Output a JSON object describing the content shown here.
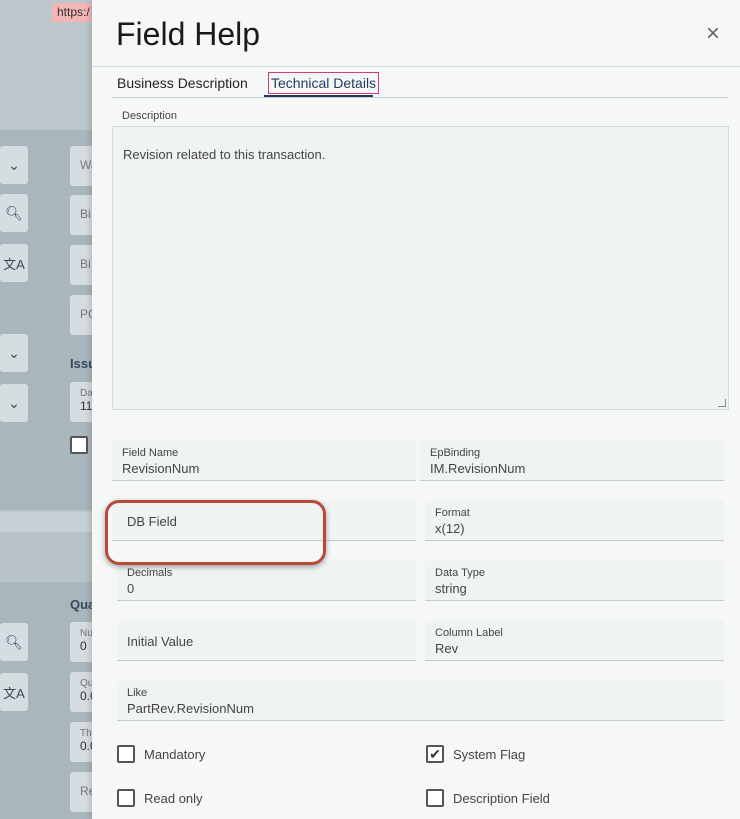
{
  "browser": {
    "url_fragment": "https:/"
  },
  "background": {
    "fields": [
      "Wa",
      "Bi",
      "Bi",
      "PC"
    ],
    "issue_label": "Issu",
    "date": {
      "label": "Da",
      "value": "11"
    },
    "qua_label": "Qua",
    "lower_fields": [
      {
        "label": "Nu",
        "value": "0"
      },
      {
        "label": "Qu",
        "value": "0.0"
      },
      {
        "label": "Th",
        "value": "0.0"
      },
      {
        "label": "",
        "value": "Re"
      }
    ]
  },
  "modal": {
    "title": "Field Help",
    "close_label": "×",
    "tabs": [
      {
        "label": "Business Description",
        "active": false
      },
      {
        "label": "Technical Details",
        "active": true
      }
    ],
    "description": {
      "label": "Description",
      "text": "Revision related to this transaction."
    },
    "fields": {
      "field_name": {
        "label": "Field Name",
        "value": "RevisionNum"
      },
      "ep_binding": {
        "label": "EpBinding",
        "value": "IM.RevisionNum"
      },
      "db_field": {
        "label": "DB Field",
        "value": ""
      },
      "format": {
        "label": "Format",
        "value": "x(12)"
      },
      "decimals": {
        "label": "Decimals",
        "value": "0"
      },
      "data_type": {
        "label": "Data Type",
        "value": "string"
      },
      "initial_value": {
        "label": "Initial Value",
        "value": ""
      },
      "column_label": {
        "label": "Column Label",
        "value": "Rev"
      },
      "like": {
        "label": "Like",
        "value": "PartRev.RevisionNum"
      }
    },
    "checkboxes": [
      {
        "label": "Mandatory",
        "checked": false
      },
      {
        "label": "System Flag",
        "checked": true
      },
      {
        "label": "Read only",
        "checked": false
      },
      {
        "label": "Description Field",
        "checked": false
      }
    ],
    "colors": {
      "accent": "#1d3a5c",
      "highlight": "#b84a3a",
      "tab_focus": "#d63a7a"
    }
  }
}
